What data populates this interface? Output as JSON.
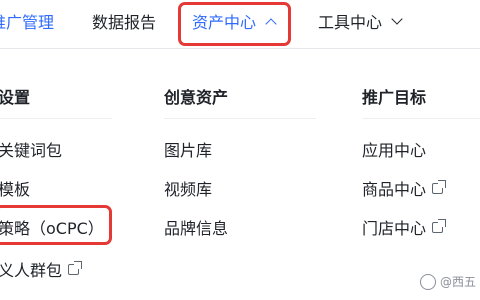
{
  "topnav": {
    "items": [
      {
        "label": "推广管理",
        "active": true
      },
      {
        "label": "数据报告"
      },
      {
        "label": "资产中心",
        "expanded": true
      },
      {
        "label": "工具中心",
        "expanded": false
      }
    ]
  },
  "dropdown": {
    "columns": [
      {
        "header": "设置",
        "items": [
          {
            "label": "关键词包"
          },
          {
            "label": "模板"
          },
          {
            "label": "策略（oCPC）",
            "highlighted": true
          },
          {
            "label": "义人群包",
            "external": true
          }
        ]
      },
      {
        "header": "创意资产",
        "items": [
          {
            "label": "图片库"
          },
          {
            "label": "视频库"
          },
          {
            "label": "品牌信息"
          }
        ]
      },
      {
        "header": "推广目标",
        "items": [
          {
            "label": "应用中心"
          },
          {
            "label": "商品中心",
            "external": true
          },
          {
            "label": "门店中心",
            "external": true
          }
        ]
      }
    ]
  },
  "watermark": {
    "text": "@西五"
  },
  "colors": {
    "accent": "#2f6bff",
    "highlight_border": "#e53935",
    "text": "#1f2329"
  },
  "icons": {
    "expanded": "chevron-up-icon",
    "collapsed": "chevron-down-icon",
    "external": "external-link-icon"
  }
}
